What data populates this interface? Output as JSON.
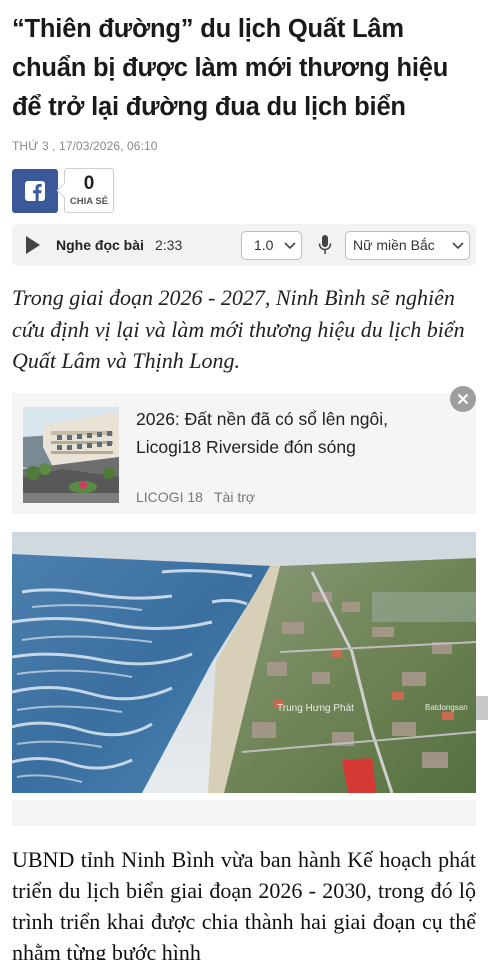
{
  "article": {
    "title": "“Thiên đường” du lịch Quất Lâm chuẩn bị được làm mới thương hiệu để trở lại đường đua du lịch biển",
    "date": "THỨ 3 , 17/03/2026, 06:10",
    "sapo": "Trong giai đoạn 2026 - 2027, Ninh Bình sẽ nghiên cứu định vị lại và làm mới thương hiệu du lịch biển Quất Lâm và Thịnh Long.",
    "body": "UBND tỉnh Ninh Bình vừa ban hành Kế hoạch phát triển du lịch biển giai đoạn 2026 - 2030, trong đó lộ trình triển khai được chia thành hai giai đoạn cụ thể nhằm từng bước hình"
  },
  "share": {
    "count": "0",
    "label": "CHIA SẺ",
    "facebook_icon": "facebook-icon",
    "facebook_color": "#3b5998"
  },
  "audio": {
    "label": "Nghe đọc bài",
    "duration": "2:33",
    "speed": "1.0",
    "voice": "Nữ miền Bắc"
  },
  "ad": {
    "title": "2026: Đất nền đã có sổ lên ngôi, Licogi18 Riverside đón sóng",
    "brand": "LICOGI 18",
    "sponsor_label": "Tài trợ"
  },
  "hero_image": {
    "credit": "Trung Hưng Phát",
    "watermark": "Batdongsan"
  }
}
